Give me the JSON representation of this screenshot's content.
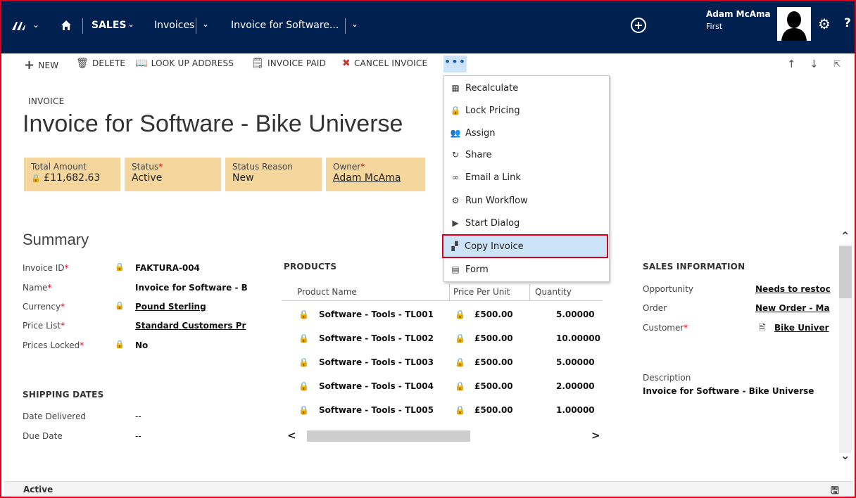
{
  "topbar": {
    "area": "SALES",
    "entity": "Invoices",
    "record": "Invoice for Software...",
    "user_name": "Adam McAma",
    "user_org": "First"
  },
  "commands": {
    "new": "NEW",
    "delete": "DELETE",
    "lookup": "LOOK UP ADDRESS",
    "paid": "INVOICE PAID",
    "cancel": "CANCEL INVOICE",
    "more": "•••"
  },
  "record": {
    "entity_label": "INVOICE",
    "title": "Invoice for Software - Bike Universe"
  },
  "header_fields": [
    {
      "label": "Total Amount",
      "value": "£11,682.63",
      "required": false
    },
    {
      "label": "Status",
      "value": "Active",
      "required": true
    },
    {
      "label": "Status Reason",
      "value": "New",
      "required": false
    },
    {
      "label": "Owner",
      "value": "Adam McAma",
      "required": true
    }
  ],
  "summary": {
    "title": "Summary",
    "fields": [
      {
        "label": "Invoice ID",
        "value": "FAKTURA-004"
      },
      {
        "label": "Name",
        "value": "Invoice for Software - B"
      },
      {
        "label": "Currency",
        "value": "Pound Sterling"
      },
      {
        "label": "Price List",
        "value": "Standard Customers Pr"
      },
      {
        "label": "Prices Locked",
        "value": "No"
      }
    ],
    "req_mark": "*"
  },
  "shipping": {
    "title": "SHIPPING DATES",
    "fields": [
      {
        "label": "Date Delivered",
        "value": "--"
      },
      {
        "label": "Due Date",
        "value": "--"
      }
    ]
  },
  "products": {
    "title": "PRODUCTS",
    "columns": [
      "Product Name",
      "Price Per Unit",
      "Quantity"
    ],
    "rows": [
      {
        "name": "Software - Tools - TL001",
        "price": "£500.00",
        "qty": "5.00000"
      },
      {
        "name": "Software - Tools - TL002",
        "price": "£500.00",
        "qty": "10.00000"
      },
      {
        "name": "Software - Tools - TL003",
        "price": "£500.00",
        "qty": "5.00000"
      },
      {
        "name": "Software - Tools - TL004",
        "price": "£500.00",
        "qty": "2.00000"
      },
      {
        "name": "Software - Tools - TL005",
        "price": "£500.00",
        "qty": "1.00000"
      }
    ]
  },
  "sales_info": {
    "title": "SALES INFORMATION",
    "fields": [
      {
        "label": "Opportunity",
        "value": "Needs to restoc"
      },
      {
        "label": "Order",
        "value": "New Order - Ma"
      },
      {
        "label": "Customer",
        "value": "Bike Univer"
      }
    ],
    "description_label": "Description",
    "description_value": "Invoice for Software - Bike Universe"
  },
  "menu": {
    "items": [
      {
        "label": "Recalculate",
        "icon": "calculator-icon"
      },
      {
        "label": "Lock Pricing",
        "icon": "lock-pricing-icon"
      },
      {
        "label": "Assign",
        "icon": "assign-icon"
      },
      {
        "label": "Share",
        "icon": "share-icon"
      },
      {
        "label": "Email a Link",
        "icon": "link-icon"
      },
      {
        "label": "Run Workflow",
        "icon": "workflow-icon"
      },
      {
        "label": "Start Dialog",
        "icon": "dialog-icon"
      },
      {
        "label": "Copy Invoice",
        "icon": "copy-invoice-icon"
      },
      {
        "label": "Form",
        "icon": "form-icon"
      }
    ],
    "highlighted": "Copy Invoice"
  },
  "footer": {
    "status": "Active"
  },
  "colors": {
    "topbar": "#002050",
    "header_field_bg": "#f5d69d",
    "highlight": "#cde3f7",
    "required": "#d9001b"
  }
}
